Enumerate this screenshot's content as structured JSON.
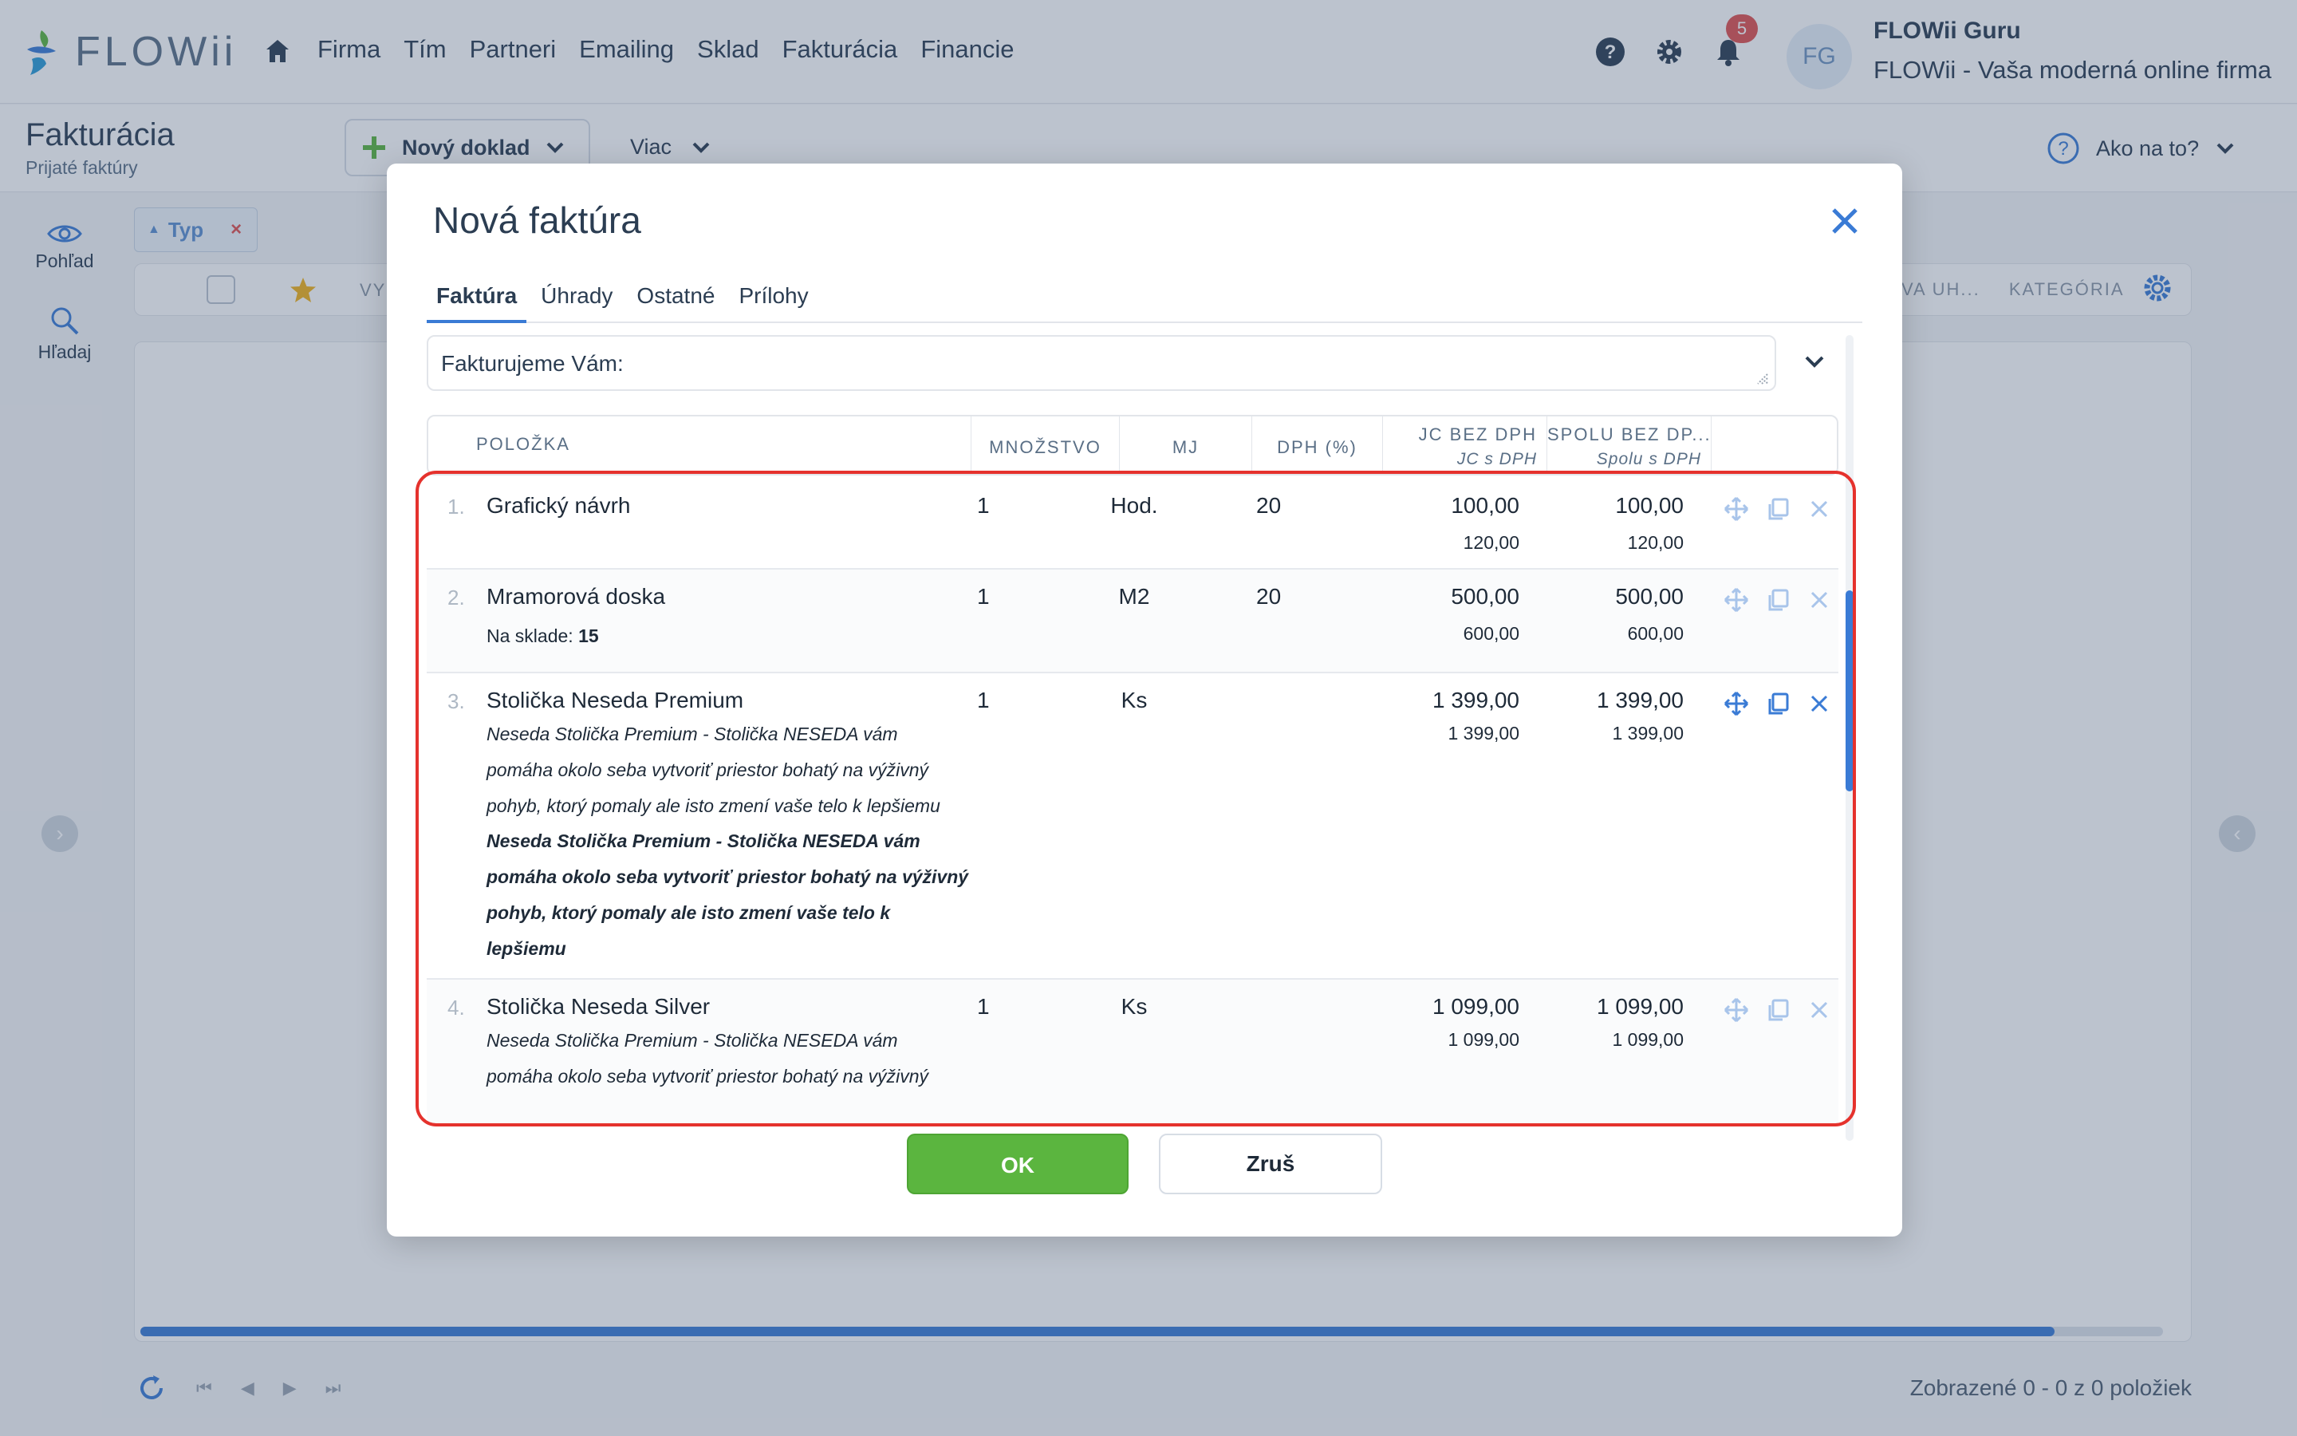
{
  "app": {
    "logo_text": "FLOWii",
    "nav": [
      "Firma",
      "Tím",
      "Partneri",
      "Emailing",
      "Sklad",
      "Fakturácia",
      "Financie"
    ],
    "notifications_count": "5",
    "avatar_initials": "FG",
    "user_name": "FLOWii Guru",
    "user_subtitle": "FLOWii - Vaša moderná online firma"
  },
  "page": {
    "title": "Fakturácia",
    "subtitle": "Prijaté faktúry",
    "new_doc_label": "Nový doklad",
    "more_label": "Viac",
    "howto_label": "Ako na to?",
    "left_view": "Pohľad",
    "left_search": "Hľadaj",
    "filter_chip": "Typ",
    "filter_remove": "×",
    "grid_header_partial_left": "VY",
    "grid_header_partial_right": "VA UH...",
    "grid_header_category": "KATEGÓRIA",
    "shown_text": "Zobrazené 0 - 0 z 0 položiek",
    "accent_color": "#3a7bd5"
  },
  "modal": {
    "title": "Nová faktúra",
    "tabs": [
      "Faktúra",
      "Úhrady",
      "Ostatné",
      "Prílohy"
    ],
    "active_tab": "Faktúra",
    "intro_text": "Fakturujeme Vám:",
    "columns": {
      "item": "POLOŽKA",
      "qty": "MNOŽSTVO",
      "unit": "MJ",
      "vat": "DPH (%)",
      "unit_price": "JC BEZ DPH",
      "unit_price_sub": "JC s DPH",
      "total": "SPOLU BEZ DP...",
      "total_sub": "Spolu s DPH"
    },
    "items": [
      {
        "no": "1.",
        "name": "Grafický návrh",
        "qty": "1",
        "unit": "Hod.",
        "vat": "20",
        "unit_price": "100,00",
        "unit_price_vat": "120,00",
        "total": "100,00",
        "total_vat": "120,00"
      },
      {
        "no": "2.",
        "name": "Mramorová doska",
        "stock_label": "Na sklade:",
        "stock_value": "15",
        "qty": "1",
        "unit": "M2",
        "vat": "20",
        "unit_price": "500,00",
        "unit_price_vat": "600,00",
        "total": "500,00",
        "total_vat": "600,00"
      },
      {
        "no": "3.",
        "name": "Stolička Neseda Premium",
        "desc_lines": [
          "Neseda Stolička Premium - Stolička NESEDA vám",
          "pomáha okolo seba vytvoriť priestor bohatý na výživný",
          "pohyb, ktorý pomaly ale isto zmení vaše telo k lepšiemu"
        ],
        "desc_bold_lines": [
          "Neseda Stolička Premium - Stolička NESEDA vám",
          "pomáha okolo seba vytvoriť priestor bohatý na výživný",
          "pohyb, ktorý pomaly ale isto zmení vaše telo k",
          "lepšiemu"
        ],
        "qty": "1",
        "unit": "Ks",
        "vat": "",
        "unit_price": "1 399,00",
        "unit_price_vat": "1 399,00",
        "total": "1 399,00",
        "total_vat": "1 399,00"
      },
      {
        "no": "4.",
        "name": "Stolička Neseda Silver",
        "desc_lines": [
          "Neseda Stolička Premium - Stolička NESEDA vám",
          "pomáha okolo seba vytvoriť priestor bohatý na výživný"
        ],
        "qty": "1",
        "unit": "Ks",
        "vat": "",
        "unit_price": "1 099,00",
        "unit_price_vat": "1 099,00",
        "total": "1 099,00",
        "total_vat": "1 099,00"
      }
    ],
    "ok_label": "OK",
    "cancel_label": "Zruš"
  }
}
